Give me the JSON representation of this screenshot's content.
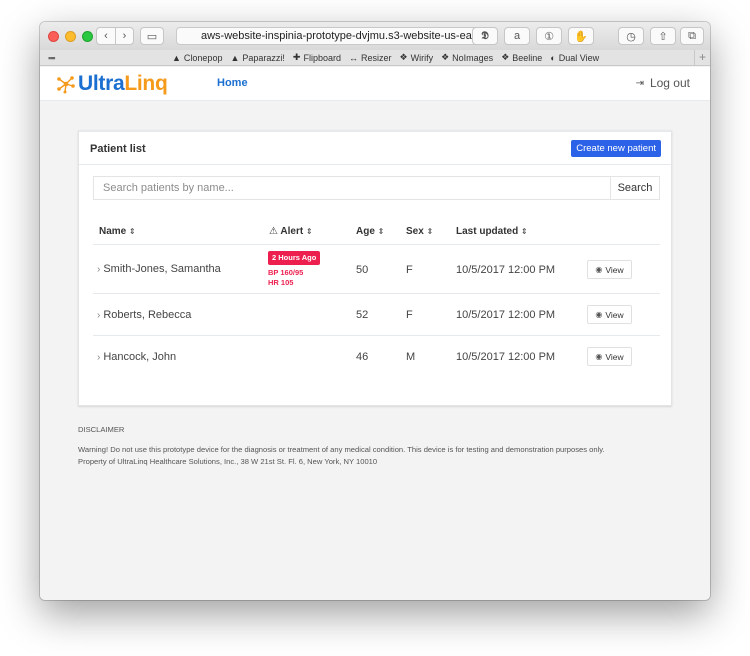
{
  "browser": {
    "url": "aws-website-inspinia-prototype-dvjmu.s3-website-us-ea",
    "bookmarks": [
      {
        "icon": "▲",
        "label": "Clonepop"
      },
      {
        "icon": "▲",
        "label": "Paparazzi!"
      },
      {
        "icon": "✚",
        "label": "Flipboard"
      },
      {
        "icon": "↔",
        "label": "Resizer"
      },
      {
        "icon": "❖",
        "label": "Wirify"
      },
      {
        "icon": "❖",
        "label": "NoImages"
      },
      {
        "icon": "❖",
        "label": "Beeline"
      },
      {
        "icon": "◐",
        "label": "Dual View"
      }
    ]
  },
  "nav": {
    "logo_part1": "Ultra",
    "logo_part2": "Linq",
    "home": "Home",
    "logout": "Log out"
  },
  "panel": {
    "title": "Patient list",
    "create_button": "Create new patient",
    "search_placeholder": "Search patients by name...",
    "search_button": "Search"
  },
  "table": {
    "headers": {
      "name": "Name",
      "alert": "Alert",
      "age": "Age",
      "sex": "Sex",
      "updated": "Last updated"
    },
    "view_label": "View",
    "rows": [
      {
        "name": "Smith-Jones, Samantha",
        "alert_badge": "2 Hours Ago",
        "alert_line1": "BP 160/95",
        "alert_line2": "HR 105",
        "age": "50",
        "sex": "F",
        "updated": "10/5/2017 12:00 PM"
      },
      {
        "name": "Roberts, Rebecca",
        "age": "52",
        "sex": "F",
        "updated": "10/5/2017 12:00 PM"
      },
      {
        "name": "Hancock, John",
        "age": "46",
        "sex": "M",
        "updated": "10/5/2017 12:00 PM"
      }
    ]
  },
  "disclaimer": {
    "title": "DISCLAIMER",
    "line1": "Warning! Do not use this prototype device for the diagnosis or treatment of any medical condition. This device is for testing and demonstration purposes only.",
    "line2": "Property of UltraLinq Healthcare Solutions, Inc., 38 W 21st St. Fl. 6, New York, NY 10010"
  },
  "colors": {
    "brand_blue": "#1b6fd0",
    "brand_orange": "#f59a1b",
    "primary_button": "#2b62e8",
    "alert_red": "#ed1f4f"
  }
}
